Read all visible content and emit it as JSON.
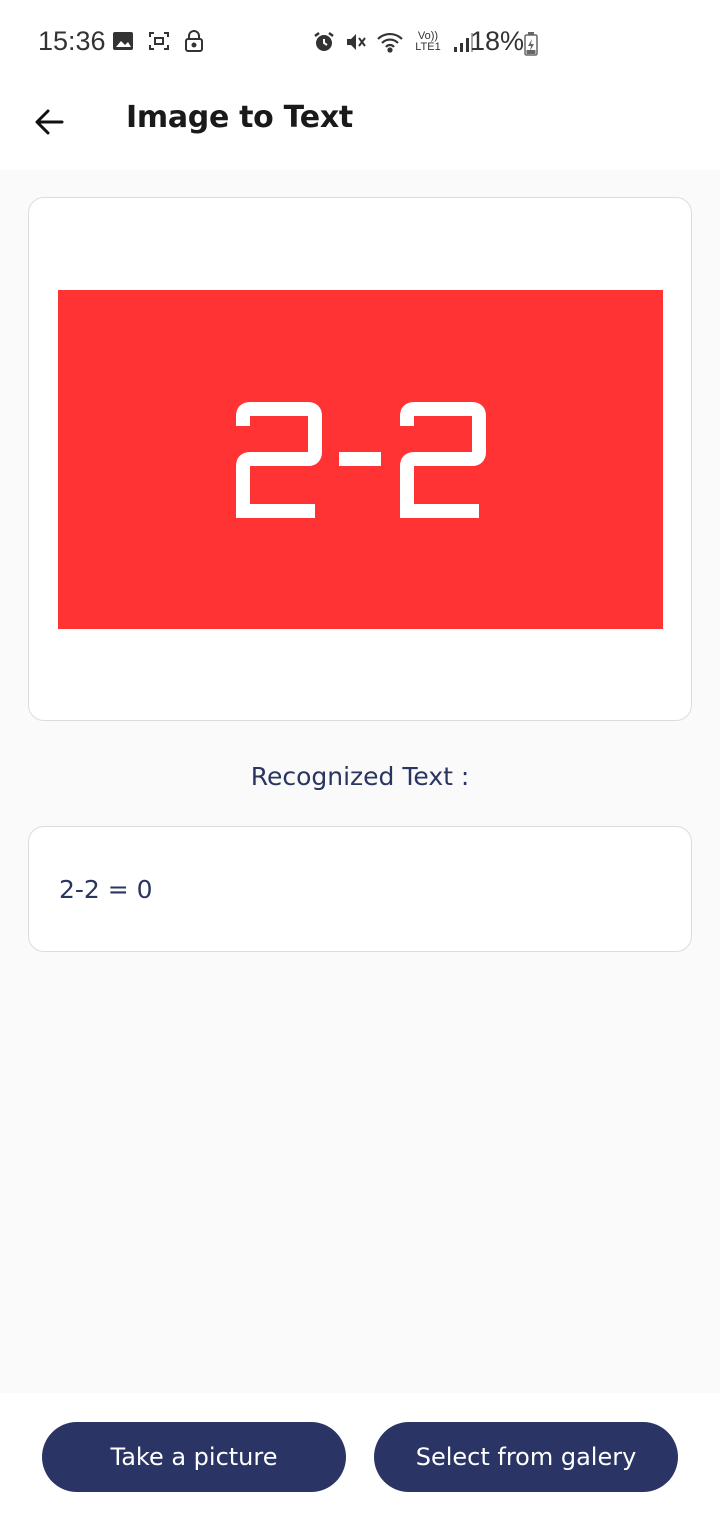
{
  "status_bar": {
    "time": "15:36",
    "battery": "18%",
    "network_label": "Vo)) LTE1",
    "left_icons": [
      "image-icon",
      "screenshot-icon",
      "lock-icon"
    ],
    "right_icons": [
      "alarm-icon",
      "mute-icon",
      "wifi-icon",
      "volte-icon",
      "signal-icon",
      "battery-icon"
    ]
  },
  "app_bar": {
    "title": "Image to Text",
    "back_icon": "arrow-left-icon"
  },
  "preview": {
    "image_text": "2-2",
    "background_color": "#ff3333"
  },
  "result": {
    "label": "Recognized Text :",
    "text": "2-2 = 0"
  },
  "actions": {
    "take_picture": "Take a picture",
    "select_gallery": "Select from galery"
  },
  "colors": {
    "primary": "#2a3565",
    "accent_text": "#2a3560"
  }
}
